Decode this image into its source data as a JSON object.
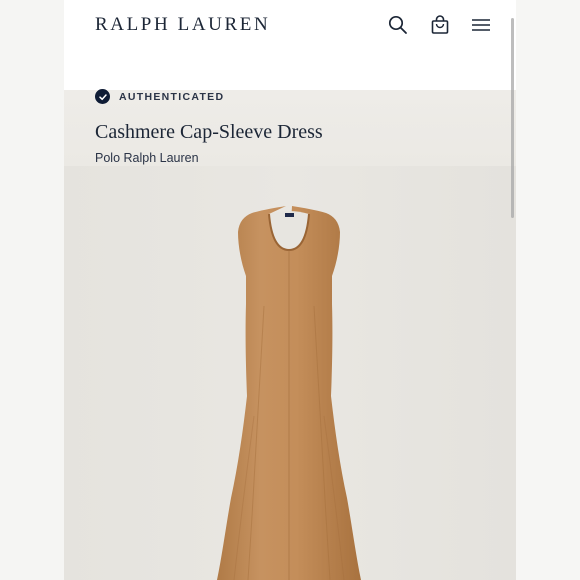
{
  "header": {
    "brand": "RALPH LAUREN",
    "icons": [
      "search-icon",
      "shopping-bag-icon",
      "menu-icon"
    ]
  },
  "product": {
    "badge": "AUTHENTICATED",
    "title": "Cashmere Cap-Sleeve Dress",
    "brand": "Polo Ralph Lauren",
    "image": "camel-cashmere-dress"
  },
  "colors": {
    "brand_navy": "#1c2636",
    "badge_navy": "#0f1c35",
    "dress_camel": "#c08a56",
    "background": "#e8e6e1"
  }
}
